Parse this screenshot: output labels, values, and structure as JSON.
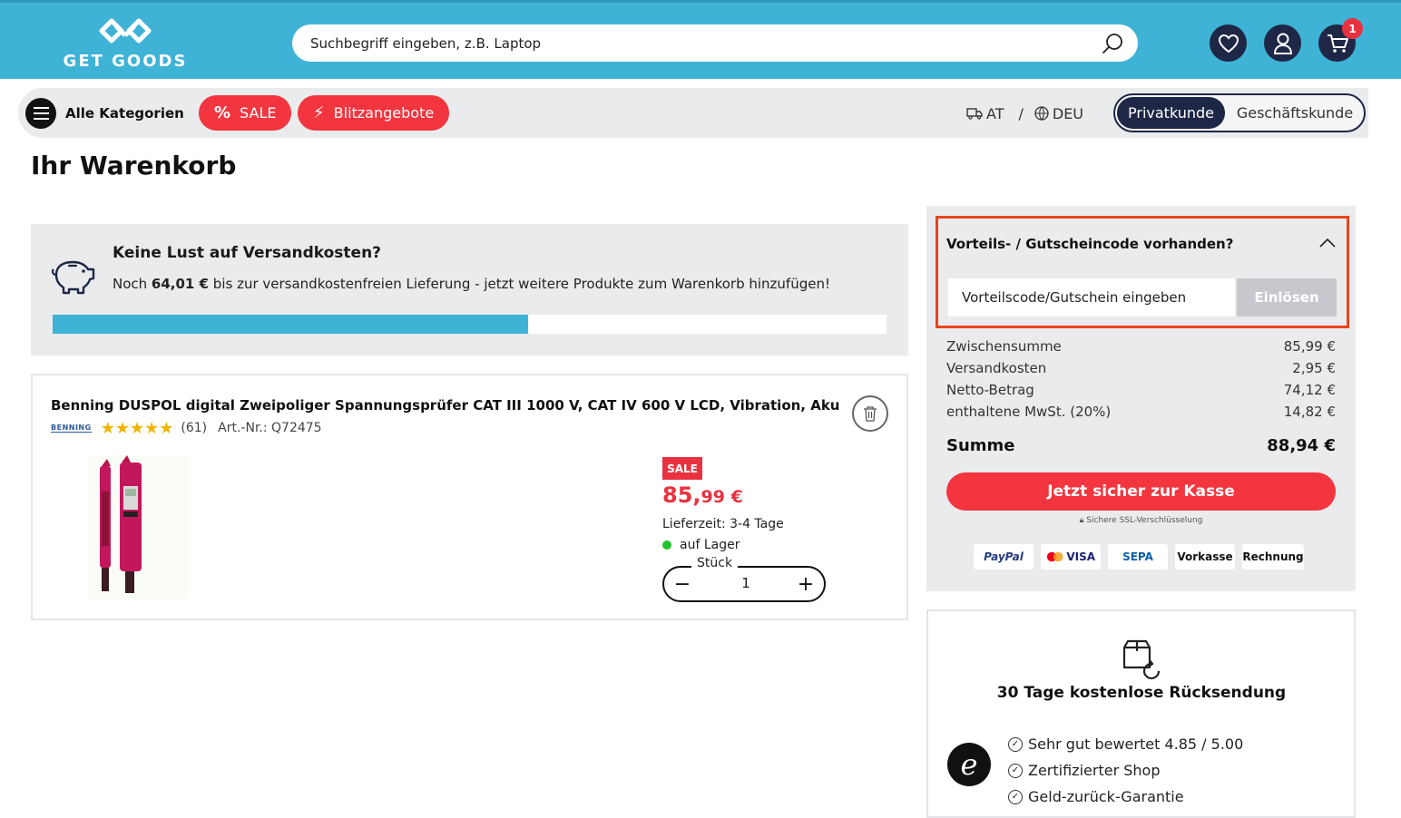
{
  "header": {
    "logo_text": "GET GOODS",
    "search_placeholder": "Suchbegriff eingeben, z.B. Laptop",
    "cart_count": "1"
  },
  "nav": {
    "categories_label": "Alle Kategorien",
    "sale_label": "SALE",
    "flash_label": "Blitzangebote",
    "country": "AT",
    "separator": "/",
    "language": "DEU",
    "customer_private": "Privatkunde",
    "customer_business": "Geschäftskunde"
  },
  "page": {
    "title": "Ihr Warenkorb"
  },
  "shipping": {
    "heading": "Keine Lust auf Versandkosten?",
    "text_prefix": "Noch ",
    "amount": "64,01 €",
    "text_suffix": " bis zur versandkostenfreien Lieferung - jetzt weitere Produkte zum Warenkorb hinzufügen!",
    "progress_percent": 57
  },
  "product": {
    "name": "Benning DUSPOL digital Zweipoliger Spannungsprüfer CAT III 1000 V, CAT IV 600 V LCD, Vibration, Aku",
    "brand": "BENNING",
    "stars": "★★★★★",
    "rating_count": "(61)",
    "article_no": "Art.-Nr.: Q72475",
    "sale_badge": "SALE",
    "price_main": "85,",
    "price_cents": "99 €",
    "delivery": "Lieferzeit: 3-4 Tage",
    "stock": "auf Lager",
    "qty_label": "Stück",
    "qty_minus": "−",
    "qty_value": "1",
    "qty_plus": "+"
  },
  "voucher": {
    "heading": "Vorteils- / Gutscheincode vorhanden?",
    "input_placeholder": "Vorteilscode/Gutschein eingeben",
    "button": "Einlösen"
  },
  "summary": {
    "lines": [
      {
        "label": "Zwischensumme",
        "value": "85,99 €"
      },
      {
        "label": "Versandkosten",
        "value": "2,95 €"
      },
      {
        "label": "Netto-Betrag",
        "value": "74,12 €"
      },
      {
        "label": "enthaltene MwSt. (20%)",
        "value": "14,82 €"
      }
    ],
    "total_label": "Summe",
    "total_value": "88,94 €",
    "checkout": "Jetzt sicher zur Kasse",
    "ssl": "Sichere SSL-Verschlüsselung",
    "payments": [
      "PayPal",
      "VISA",
      "SEPA",
      "Vorkasse",
      "Rechnung"
    ]
  },
  "trust": {
    "return_title": "30 Tage kostenlose Rücksendung",
    "items": [
      "Sehr gut bewertet 4.85 / 5.00",
      "Zertifizierter Shop",
      "Geld-zurück-Garantie"
    ],
    "logo_letter": "e"
  },
  "colors": {
    "header_bg": "#3fb3d6",
    "accent_red": "#f2353f",
    "navy": "#1e2745",
    "highlight_border": "#e8451e"
  }
}
